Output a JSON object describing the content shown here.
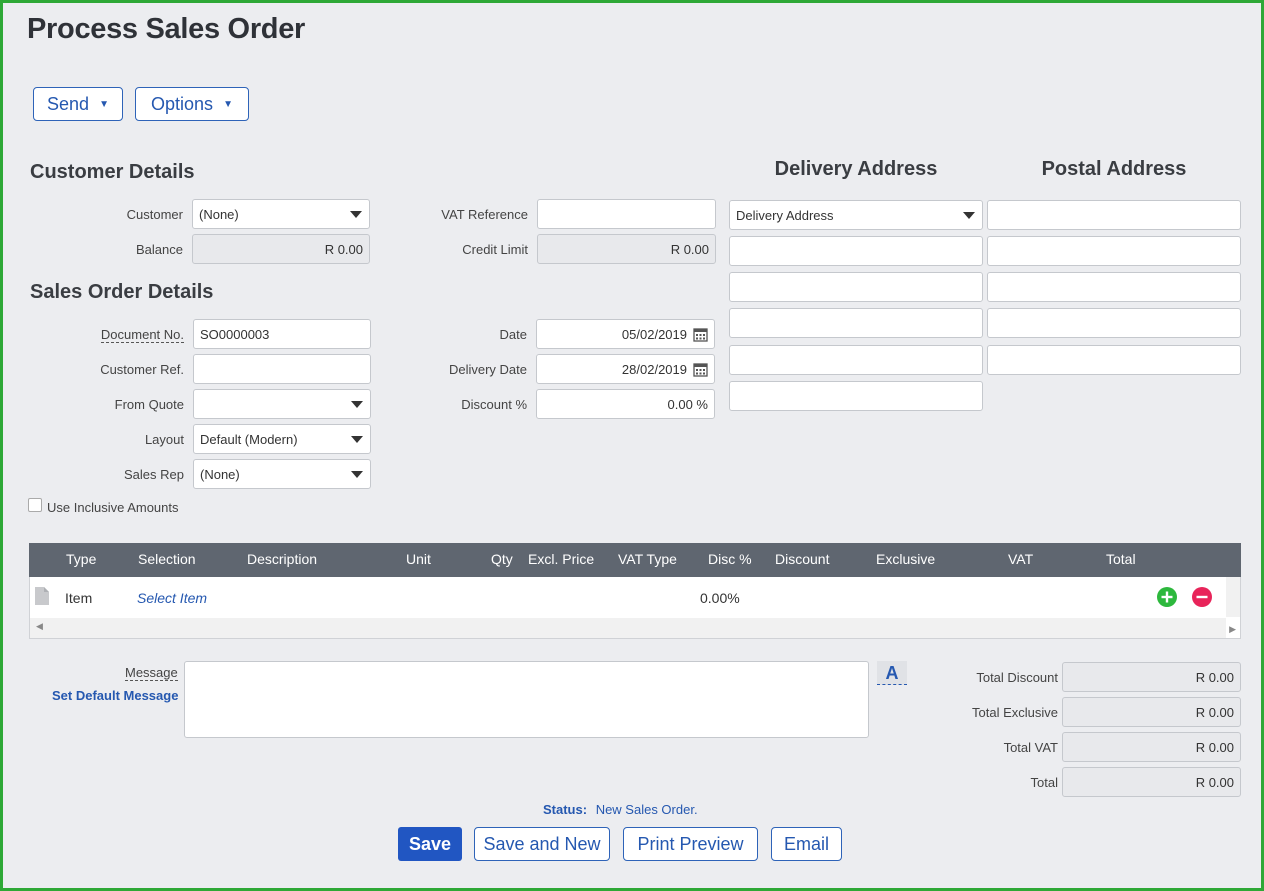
{
  "page": {
    "title": "Process Sales Order"
  },
  "toolbar": {
    "send": "Send",
    "options": "Options"
  },
  "customer_details": {
    "heading": "Customer Details",
    "customer_label": "Customer",
    "customer_value": "(None)",
    "balance_label": "Balance",
    "balance_value": "R 0.00",
    "vat_ref_label": "VAT Reference",
    "vat_ref_value": "",
    "credit_limit_label": "Credit Limit",
    "credit_limit_value": "R 0.00"
  },
  "sales_order_details": {
    "heading": "Sales Order Details",
    "document_no_label": "Document No.",
    "document_no_value": "SO0000003",
    "customer_ref_label": "Customer Ref.",
    "customer_ref_value": "",
    "from_quote_label": "From Quote",
    "from_quote_value": "",
    "layout_label": "Layout",
    "layout_value": "Default (Modern)",
    "sales_rep_label": "Sales Rep",
    "sales_rep_value": "(None)",
    "date_label": "Date",
    "date_value": "05/02/2019",
    "delivery_date_label": "Delivery Date",
    "delivery_date_value": "28/02/2019",
    "discount_label": "Discount %",
    "discount_value": "0.00 %",
    "inclusive_label": "Use Inclusive Amounts"
  },
  "delivery_address": {
    "heading": "Delivery Address",
    "select_value": "Delivery Address"
  },
  "postal_address": {
    "heading": "Postal Address"
  },
  "grid": {
    "headers": {
      "type": "Type",
      "selection": "Selection",
      "description": "Description",
      "unit": "Unit",
      "qty": "Qty",
      "excl_price": "Excl. Price",
      "vat_type": "VAT Type",
      "disc": "Disc %",
      "discount": "Discount",
      "exclusive": "Exclusive",
      "vat": "VAT",
      "total": "Total"
    },
    "row": {
      "type": "Item",
      "selection": "Select Item",
      "disc": "0.00%"
    }
  },
  "message": {
    "label": "Message",
    "set_default": "Set Default Message",
    "font_button": "A"
  },
  "totals": {
    "discount_label": "Total Discount",
    "discount_value": "R 0.00",
    "exclusive_label": "Total Exclusive",
    "exclusive_value": "R 0.00",
    "vat_label": "Total VAT",
    "vat_value": "R 0.00",
    "total_label": "Total",
    "total_value": "R 0.00"
  },
  "status": {
    "label": "Status:",
    "value": "New Sales Order."
  },
  "actions": {
    "save": "Save",
    "save_new": "Save and New",
    "print_preview": "Print Preview",
    "email": "Email"
  },
  "colors": {
    "accent": "#2156c2",
    "frame": "#2ea836",
    "add": "#2db83d",
    "remove": "#e8245a"
  }
}
